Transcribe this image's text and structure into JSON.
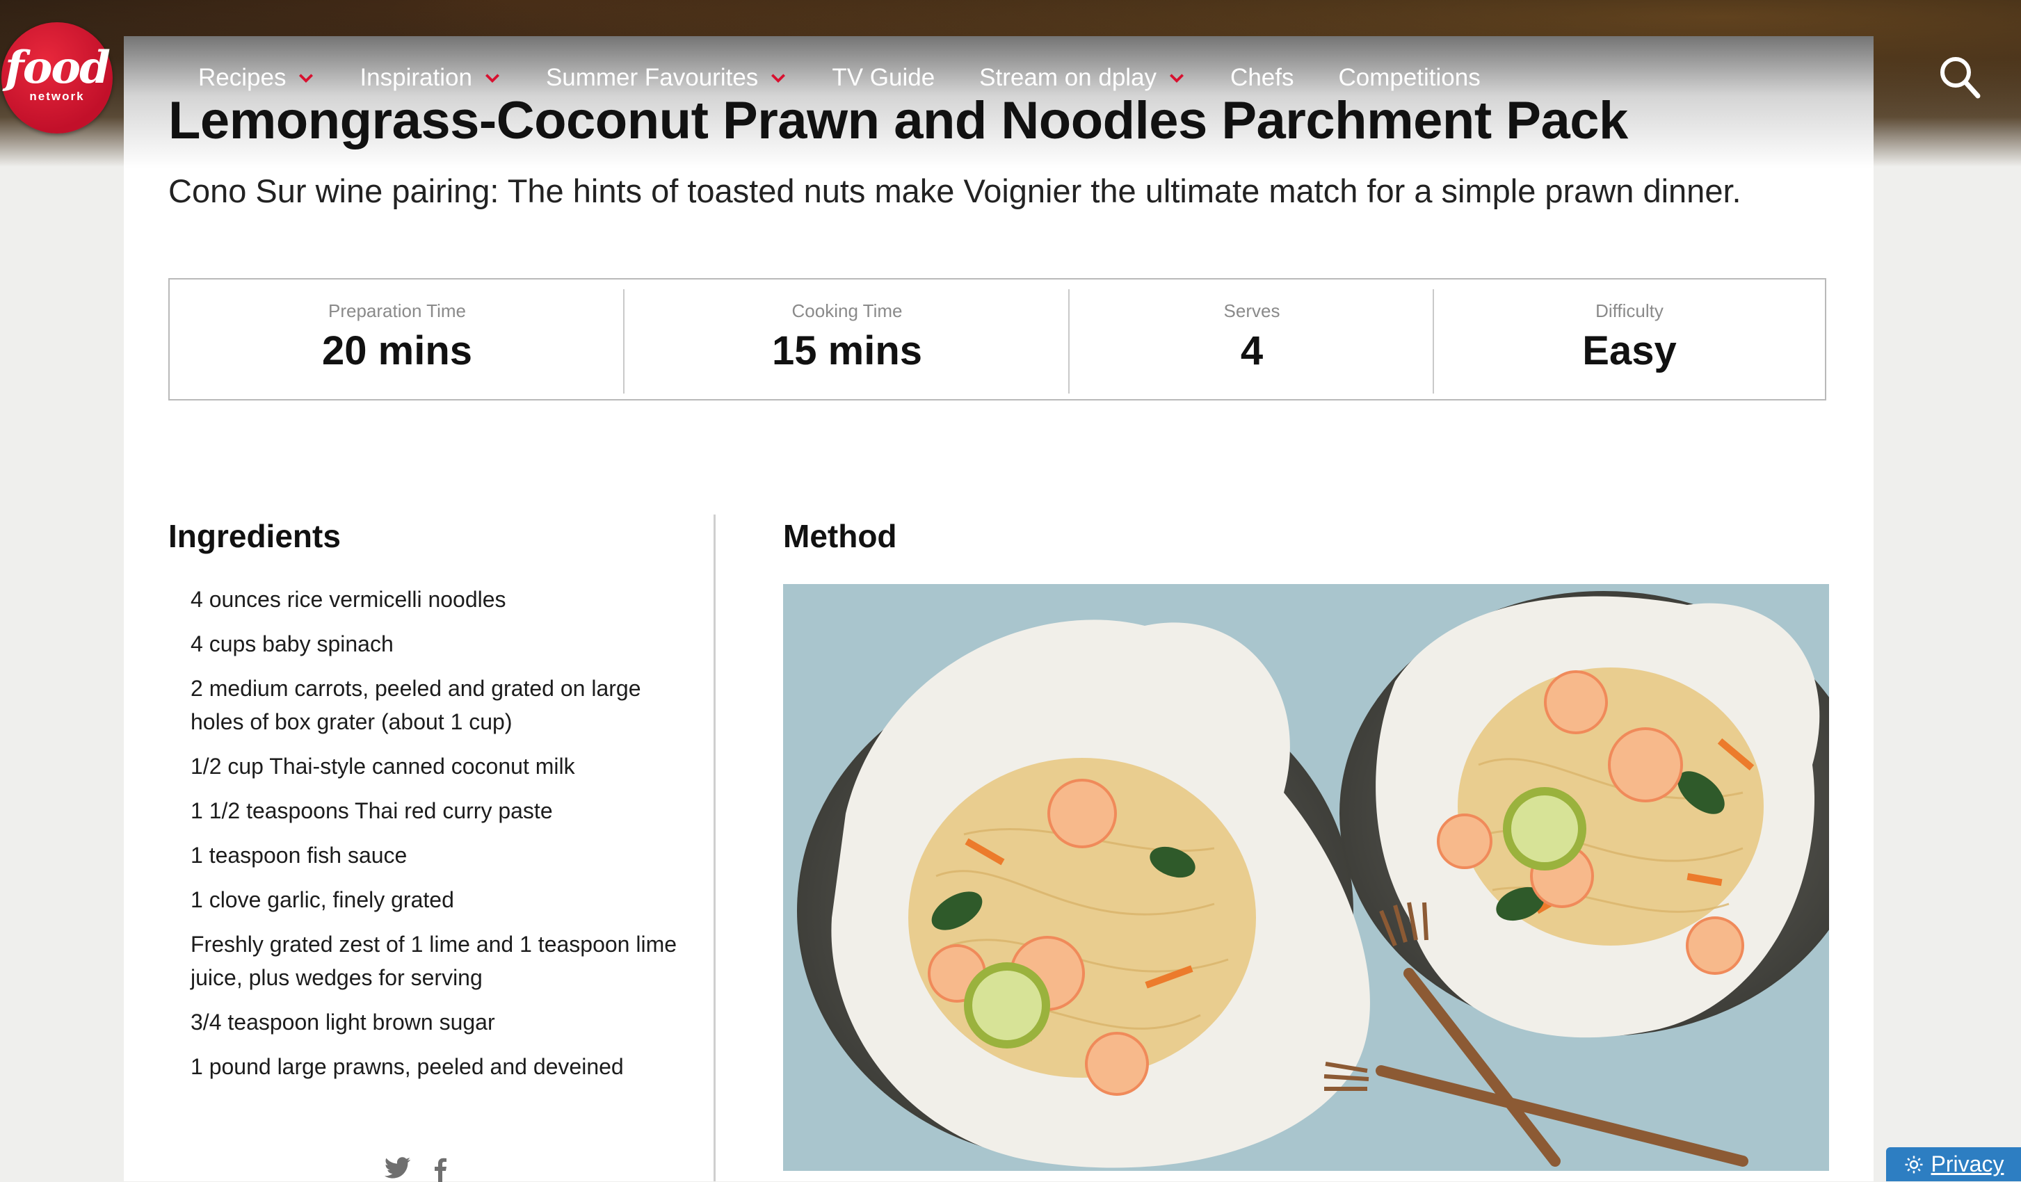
{
  "brand": {
    "logo_word": "food",
    "logo_sub": "network"
  },
  "nav": {
    "items": [
      {
        "label": "Recipes",
        "has_dropdown": true
      },
      {
        "label": "Inspiration",
        "has_dropdown": true
      },
      {
        "label": "Summer Favourites",
        "has_dropdown": true
      },
      {
        "label": "TV Guide",
        "has_dropdown": false
      },
      {
        "label": "Stream on dplay",
        "has_dropdown": true
      },
      {
        "label": "Chefs",
        "has_dropdown": false
      },
      {
        "label": "Competitions",
        "has_dropdown": false
      }
    ],
    "dropdown_color": "#d8102f",
    "search_icon": "search-icon"
  },
  "recipe": {
    "title": "Lemongrass-Coconut Prawn and Noodles Parchment Pack",
    "subtitle": "Cono Sur wine pairing: The hints of toasted nuts make Voignier the ultimate match for a simple prawn dinner.",
    "stats": [
      {
        "label": "Preparation Time",
        "value": "20 mins"
      },
      {
        "label": "Cooking Time",
        "value": "15 mins"
      },
      {
        "label": "Serves",
        "value": "4"
      },
      {
        "label": "Difficulty",
        "value": "Easy"
      }
    ],
    "ingredients_heading": "Ingredients",
    "ingredients": [
      "4 ounces rice vermicelli noodles",
      "4 cups baby spinach",
      "2 medium carrots, peeled and grated on large holes of box grater (about 1 cup)",
      "1/2 cup Thai-style canned coconut milk",
      "1 1/2 teaspoons Thai red curry paste",
      "1 teaspoon fish sauce",
      "1 clove garlic, finely grated",
      "Freshly grated zest of 1 lime and 1 teaspoon lime juice, plus wedges for serving",
      "3/4 teaspoon light brown sugar",
      "1 pound large prawns, peeled and deveined"
    ],
    "method_heading": "Method",
    "share_icons": [
      "twitter-icon",
      "facebook-icon"
    ]
  },
  "privacy": {
    "label": "Privacy",
    "color": "#2d7ec2"
  }
}
